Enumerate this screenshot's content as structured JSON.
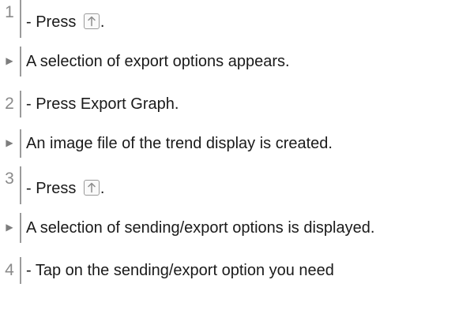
{
  "steps": [
    {
      "kind": "step",
      "marker": "1",
      "prefix": "- Press",
      "icon": "share-arrow-up-icon",
      "suffix": "."
    },
    {
      "kind": "result",
      "marker": "▶",
      "text": "A selection of export options appears."
    },
    {
      "kind": "step",
      "marker": "2",
      "text": "- Press Export Graph."
    },
    {
      "kind": "result",
      "marker": "▶",
      "text": "An image file of the trend display is created."
    },
    {
      "kind": "step",
      "marker": "3",
      "prefix": "- Press",
      "icon": "share-arrow-up-icon",
      "suffix": "."
    },
    {
      "kind": "result",
      "marker": "▶",
      "text": "A selection of sending/export options is displayed."
    },
    {
      "kind": "step",
      "marker": "4",
      "text": "- Tap on the sending/export option you need"
    }
  ]
}
